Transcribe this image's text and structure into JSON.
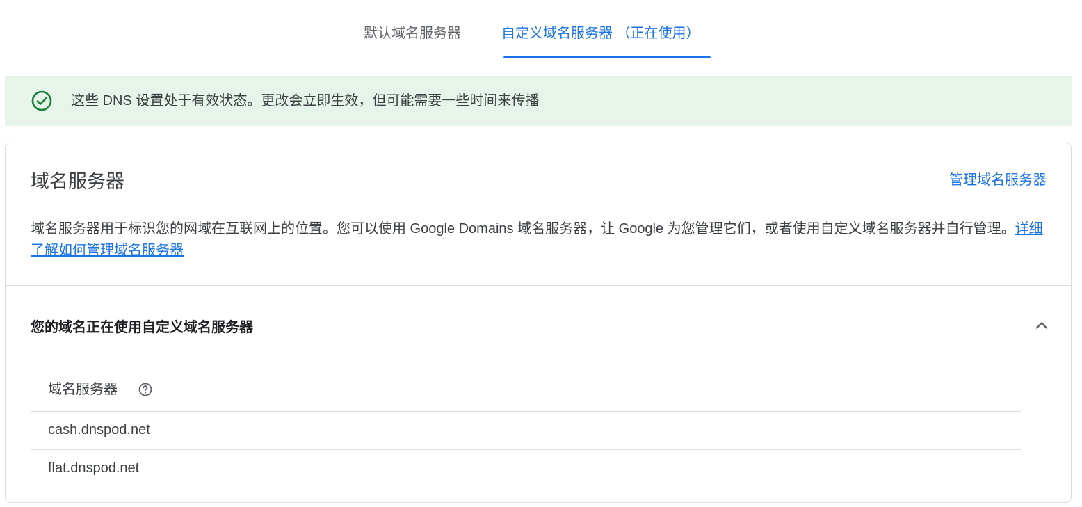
{
  "tabs": [
    {
      "label": "默认域名服务器"
    },
    {
      "label": "自定义域名服务器 （正在使用）"
    }
  ],
  "banner": {
    "icon": "check-circle-icon",
    "text": "这些 DNS 设置处于有效状态。更改会立即生效，但可能需要一些时间来传播",
    "color": "#e6f4ea"
  },
  "card": {
    "title": "域名服务器",
    "manage_link": "管理域名服务器",
    "description": "域名服务器用于标识您的网域在互联网上的位置。您可以使用 Google Domains 域名服务器，让 Google 为您管理它们，或者使用自定义域名服务器并自行管理。",
    "learn_more_link": "详细了解如何管理域名服务器"
  },
  "section": {
    "title": "您的域名正在使用自定义域名服务器",
    "table_header": "域名服务器",
    "nameservers": [
      "cash.dnspod.net",
      "flat.dnspod.net"
    ]
  },
  "colors": {
    "accent": "#1a73e8",
    "success": "#188038"
  }
}
